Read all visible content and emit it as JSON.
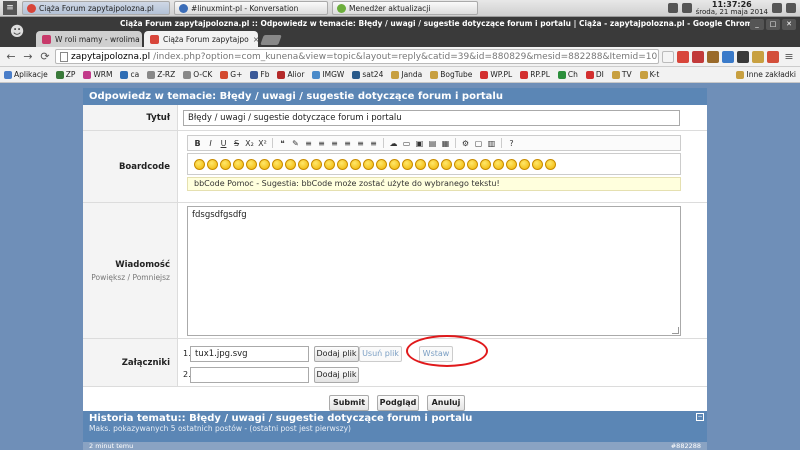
{
  "os": {
    "tasks": [
      {
        "label": "Ciąża Forum zapytajpolozna.pl",
        "color": "#d8453a"
      },
      {
        "label": "#linuxmint-pl - Konversation",
        "color": "#3b6db8"
      },
      {
        "label": "Menedżer aktualizacji",
        "color": "#6cae3c"
      }
    ],
    "time": "11:37:26",
    "date": "środa, 21 maja 2014"
  },
  "browser": {
    "window_title": "Ciąża Forum zapytajpolozna.pl :: Odpowiedz w temacie: Błędy / uwagi / sugestie dotyczące forum i portalu | Ciąża - zapytajpolozna.pl - Google Chrome",
    "tabs": [
      {
        "label": "W roli mamy - wrolima"
      },
      {
        "label": "Ciąża Forum zapytajpo"
      }
    ],
    "url_host": "zapytajpolozna.pl",
    "url_path": "/index.php?option=com_kunena&view=topic&layout=reply&catid=39&id=880829&mesid=882288&Itemid=103"
  },
  "bookmarks": [
    {
      "label": "Aplikacje",
      "color": "#4a7ec9"
    },
    {
      "label": "ZP",
      "color": "#3a7a3a"
    },
    {
      "label": "WRM",
      "color": "#c23a8a"
    },
    {
      "label": "ca",
      "color": "#2e6db4"
    },
    {
      "label": "Z-RZ",
      "color": "#888888"
    },
    {
      "label": "O-CK",
      "color": "#888888"
    },
    {
      "label": "G+",
      "color": "#d44a2f"
    },
    {
      "label": "Fb",
      "color": "#3b5998"
    },
    {
      "label": "Alior",
      "color": "#b42a2a"
    },
    {
      "label": "IMGW",
      "color": "#4a8ac9"
    },
    {
      "label": "sat24",
      "color": "#2a5a8a"
    },
    {
      "label": "Janda",
      "color": "#c8a040",
      "folder": true
    },
    {
      "label": "BogTube",
      "color": "#c8a040",
      "folder": true
    },
    {
      "label": "WP.PL",
      "color": "#d32f2f"
    },
    {
      "label": "RP.PL",
      "color": "#d32f2f"
    },
    {
      "label": "Ch",
      "color": "#2c8f3c"
    },
    {
      "label": "DI",
      "color": "#d32f2f"
    },
    {
      "label": "TV",
      "color": "#c8a040",
      "folder": true
    },
    {
      "label": "K-t",
      "color": "#c8a040",
      "folder": true
    }
  ],
  "other_bookmarks": "Inne zakładki",
  "form": {
    "heading": "Odpowiedz w temacie: Błędy / uwagi / sugestie dotyczące forum i portalu",
    "title_label": "Tytuł",
    "title_value": "Błędy / uwagi / sugestie dotyczące forum i portalu",
    "boardcode_label": "Boardcode",
    "boardcode_hint": "bbCode Pomoc - Sugestia: bbCode może zostać użyte do wybranego tekstu!",
    "message_label": "Wiadomość",
    "message_sub": "Powiększ / Pomniejsz",
    "message_value": "fdsgsdfgsdfg",
    "attachments_label": "Załączniki",
    "attachment1_index": "1.",
    "attachment1_value": "tux1.jpg.svg",
    "attachment2_index": "2.",
    "attachment2_value": "",
    "add_file_label": "Dodaj plik",
    "remove_file_label": "Usuń plik",
    "insert_label": "Wstaw",
    "submit_label": "Submit",
    "preview_label": "Podgląd",
    "cancel_label": "Anuluj"
  },
  "history": {
    "title": "Historia tematu:: Błędy / uwagi / sugestie dotyczące forum i portalu",
    "subtitle": "Maks. pokazywanych 5 ostatnich postów - (ostatni post jest pierwszy)",
    "bottom_left": "2 minut temu",
    "bottom_right": "#882288"
  },
  "toolbar_glyphs": [
    "B",
    "I",
    "U",
    "S",
    "X₂",
    "X²",
    "❝",
    "✎",
    "≡",
    "≡",
    "≡",
    "≡",
    "≡",
    "≡",
    "☁",
    "▭",
    "▣",
    "▤",
    "▦",
    "⚙",
    "▢",
    "▥",
    "?"
  ],
  "smiley_count": 28
}
